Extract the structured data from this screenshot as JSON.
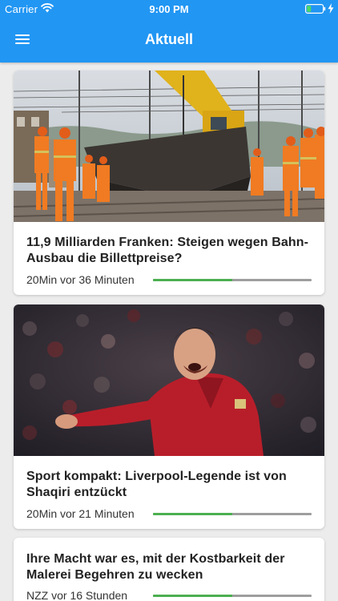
{
  "status_bar": {
    "carrier": "Carrier",
    "time": "9:00 PM",
    "icons": [
      "wifi-icon",
      "battery-icon",
      "charging-icon"
    ]
  },
  "header": {
    "title": "Aktuell",
    "menu_icon": "menu-icon"
  },
  "colors": {
    "header_bg": "#2196f3",
    "page_bg": "#ececec",
    "card_bg": "#ffffff",
    "progress_done": "#4caf50",
    "progress_track": "#9e9e9e"
  },
  "articles": [
    {
      "image": "railway-construction-photo",
      "title": "11,9 Milliarden Franken: Steigen wegen Bahn-Ausbau die Billettpreise?",
      "meta": "20Min vor 36 Minuten",
      "progress": 0.5
    },
    {
      "image": "football-player-celebration-photo",
      "title": "Sport kompakt: Liverpool-Legende ist von Shaqiri entzückt",
      "meta": "20Min vor 21 Minuten",
      "progress": 0.5
    },
    {
      "title": "Ihre Macht war es, mit der Kostbarkeit der Malerei Begehren zu wecken",
      "meta": "NZZ vor 16 Stunden",
      "progress": 0.5
    }
  ]
}
